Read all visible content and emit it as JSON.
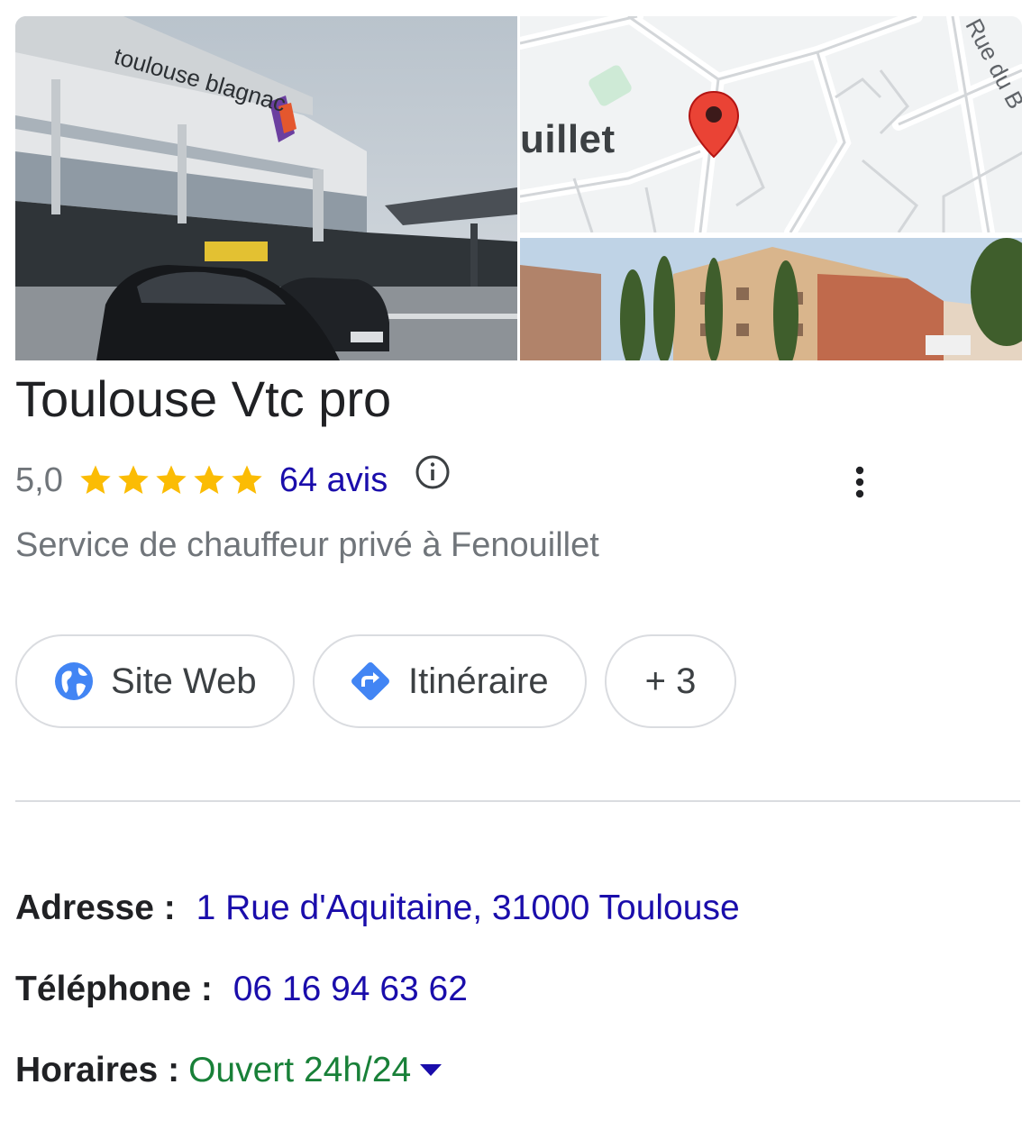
{
  "media": {
    "main_photo_sign": "toulouse blagnac",
    "map_locality": "uillet",
    "map_street": "Rue du B"
  },
  "business": {
    "name": "Toulouse Vtc pro",
    "rating": "5,0",
    "stars": 5,
    "reviews_label": "64 avis",
    "category": "Service de chauffeur privé à Fenouillet"
  },
  "actions": {
    "website_label": "Site Web",
    "directions_label": "Itinéraire",
    "more_label": "+ 3"
  },
  "details": {
    "address_label": "Adresse :",
    "address_value": "1 Rue d'Aquitaine, 31000 Toulouse",
    "phone_label": "Téléphone :",
    "phone_value": "06 16 94 63 62",
    "hours_label": "Horaires :",
    "hours_value": "Ouvert 24h/24"
  },
  "colors": {
    "link": "#1a0dab",
    "star": "#fbbc04",
    "open": "#188038",
    "icon_blue": "#4285f4",
    "pin": "#ea4335"
  },
  "icons": {
    "info": "info-icon",
    "more": "more-vert-icon",
    "website": "globe-icon",
    "directions": "directions-icon",
    "hours_toggle": "caret-down-icon"
  }
}
